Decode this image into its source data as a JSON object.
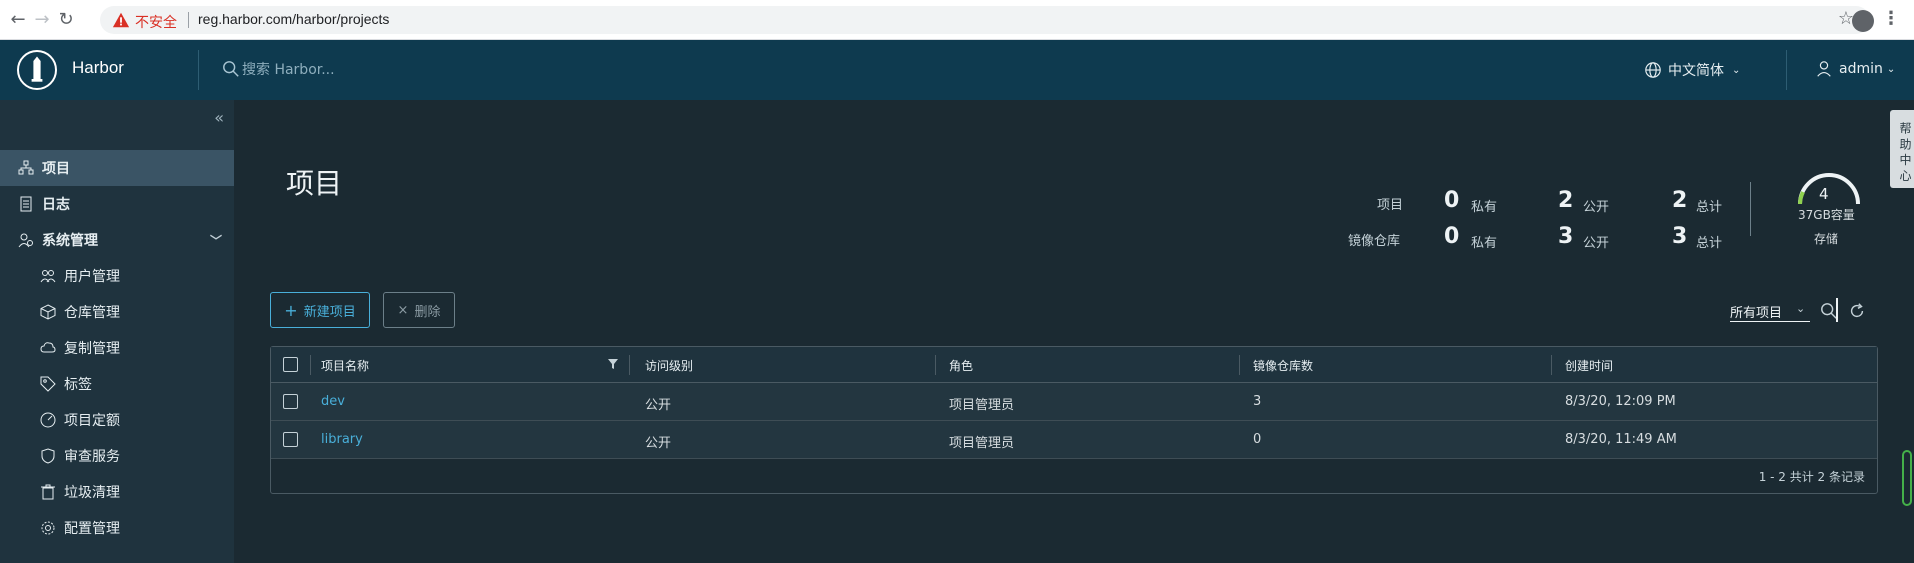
{
  "browser": {
    "warning": "不安全",
    "url": "reg.harbor.com/harbor/projects"
  },
  "header": {
    "app_title": "Harbor",
    "search_placeholder": "搜索 Harbor...",
    "language": "中文简体",
    "user": "admin"
  },
  "sidebar": {
    "items": [
      {
        "label": "项目",
        "icon": "projects-icon"
      },
      {
        "label": "日志",
        "icon": "log-icon"
      },
      {
        "label": "系统管理",
        "icon": "admin-icon"
      },
      {
        "label": "用户管理",
        "icon": "users-icon"
      },
      {
        "label": "仓库管理",
        "icon": "registry-icon"
      },
      {
        "label": "复制管理",
        "icon": "replication-icon"
      },
      {
        "label": "标签",
        "icon": "tag-icon"
      },
      {
        "label": "项目定额",
        "icon": "quota-icon"
      },
      {
        "label": "审查服务",
        "icon": "shield-icon"
      },
      {
        "label": "垃圾清理",
        "icon": "trash-icon"
      },
      {
        "label": "配置管理",
        "icon": "gear-icon"
      }
    ]
  },
  "main": {
    "title": "项目",
    "stats": {
      "projects_label": "项目",
      "repos_label": "镜像仓库",
      "private_label": "私有",
      "public_label": "公开",
      "total_label": "总计",
      "projects_private": "0",
      "projects_public": "2",
      "projects_total": "2",
      "repos_private": "0",
      "repos_public": "3",
      "repos_total": "3"
    },
    "storage": {
      "count": "4",
      "capacity": "37GB容量",
      "label": "存储"
    },
    "new_button": "新建项目",
    "delete_button": "删除",
    "filter_select": "所有项目",
    "table": {
      "columns": [
        "项目名称",
        "访问级别",
        "角色",
        "镜像仓库数",
        "创建时间"
      ],
      "rows": [
        {
          "name": "dev",
          "access": "公开",
          "role": "项目管理员",
          "repos": "3",
          "created": "8/3/20, 12:09 PM"
        },
        {
          "name": "library",
          "access": "公开",
          "role": "项目管理员",
          "repos": "0",
          "created": "8/3/20, 11:49 AM"
        }
      ],
      "footer": "1 - 2 共计 2 条记录"
    },
    "side_tab": "帮 助 中 心"
  },
  "colors": {
    "header_bg": "#0e3a4f",
    "sidebar_bg": "#1f333e",
    "main_bg": "#1b2a32",
    "accent": "#49afd9"
  }
}
